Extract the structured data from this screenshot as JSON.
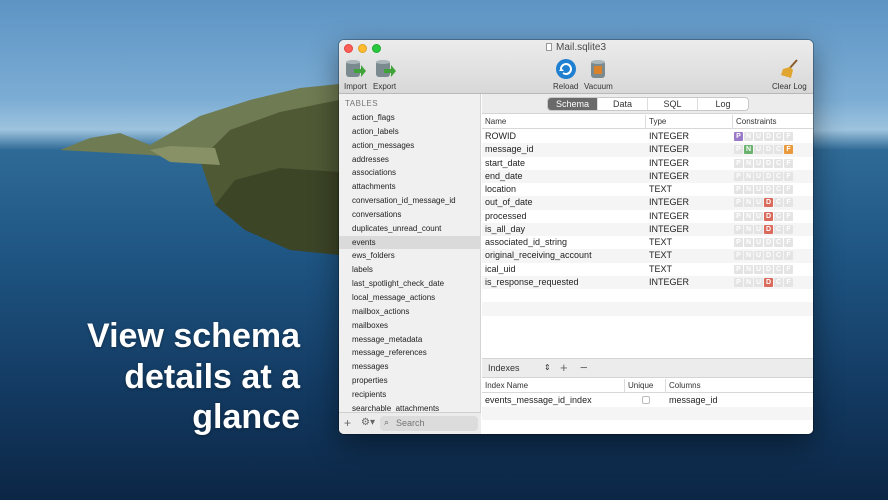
{
  "marketing": {
    "line1": "View schema",
    "line2": "details at a",
    "line3": "glance"
  },
  "window": {
    "title": "Mail.sqlite3"
  },
  "toolbar": {
    "import": "Import",
    "export": "Export",
    "reload": "Reload",
    "vacuum": "Vacuum",
    "clear_log": "Clear Log"
  },
  "sidebar": {
    "header": "TABLES",
    "items": [
      "action_flags",
      "action_labels",
      "action_messages",
      "addresses",
      "associations",
      "attachments",
      "conversation_id_message_id",
      "conversations",
      "duplicates_unread_count",
      "events",
      "ews_folders",
      "labels",
      "last_spotlight_check_date",
      "local_message_actions",
      "mailbox_actions",
      "mailboxes",
      "message_metadata",
      "message_references",
      "messages",
      "properties",
      "recipients",
      "searchable_attachments"
    ],
    "selected": "events",
    "search_placeholder": "Search"
  },
  "tabs": [
    "Schema",
    "Data",
    "SQL",
    "Log"
  ],
  "active_tab": "Schema",
  "schema": {
    "headers": {
      "name": "Name",
      "type": "Type",
      "constraints": "Constraints"
    },
    "constraint_letters": [
      "P",
      "N",
      "U",
      "D",
      "C",
      "F"
    ],
    "constraint_colors": {
      "P": "#9b79c9",
      "N": "#6bb26f",
      "U": "#8aa8d8",
      "D": "#d96a5c",
      "C": "#e6c27a",
      "F": "#e89a3c",
      "off": "#e4e4e4"
    },
    "rows": [
      {
        "name": "ROWID",
        "type": "INTEGER",
        "on": [
          "P"
        ]
      },
      {
        "name": "message_id",
        "type": "INTEGER",
        "on": [
          "N",
          "F"
        ]
      },
      {
        "name": "start_date",
        "type": "INTEGER",
        "on": []
      },
      {
        "name": "end_date",
        "type": "INTEGER",
        "on": []
      },
      {
        "name": "location",
        "type": "TEXT",
        "on": []
      },
      {
        "name": "out_of_date",
        "type": "INTEGER",
        "on": [
          "D"
        ]
      },
      {
        "name": "processed",
        "type": "INTEGER",
        "on": [
          "D"
        ]
      },
      {
        "name": "is_all_day",
        "type": "INTEGER",
        "on": [
          "D"
        ]
      },
      {
        "name": "associated_id_string",
        "type": "TEXT",
        "on": []
      },
      {
        "name": "original_receiving_account",
        "type": "TEXT",
        "on": []
      },
      {
        "name": "ical_uid",
        "type": "TEXT",
        "on": []
      },
      {
        "name": "is_response_requested",
        "type": "INTEGER",
        "on": [
          "D"
        ]
      }
    ]
  },
  "indexes": {
    "label": "Indexes",
    "headers": {
      "name": "Index Name",
      "unique": "Unique",
      "columns": "Columns"
    },
    "rows": [
      {
        "name": "events_message_id_index",
        "unique": false,
        "columns": "message_id"
      }
    ]
  }
}
